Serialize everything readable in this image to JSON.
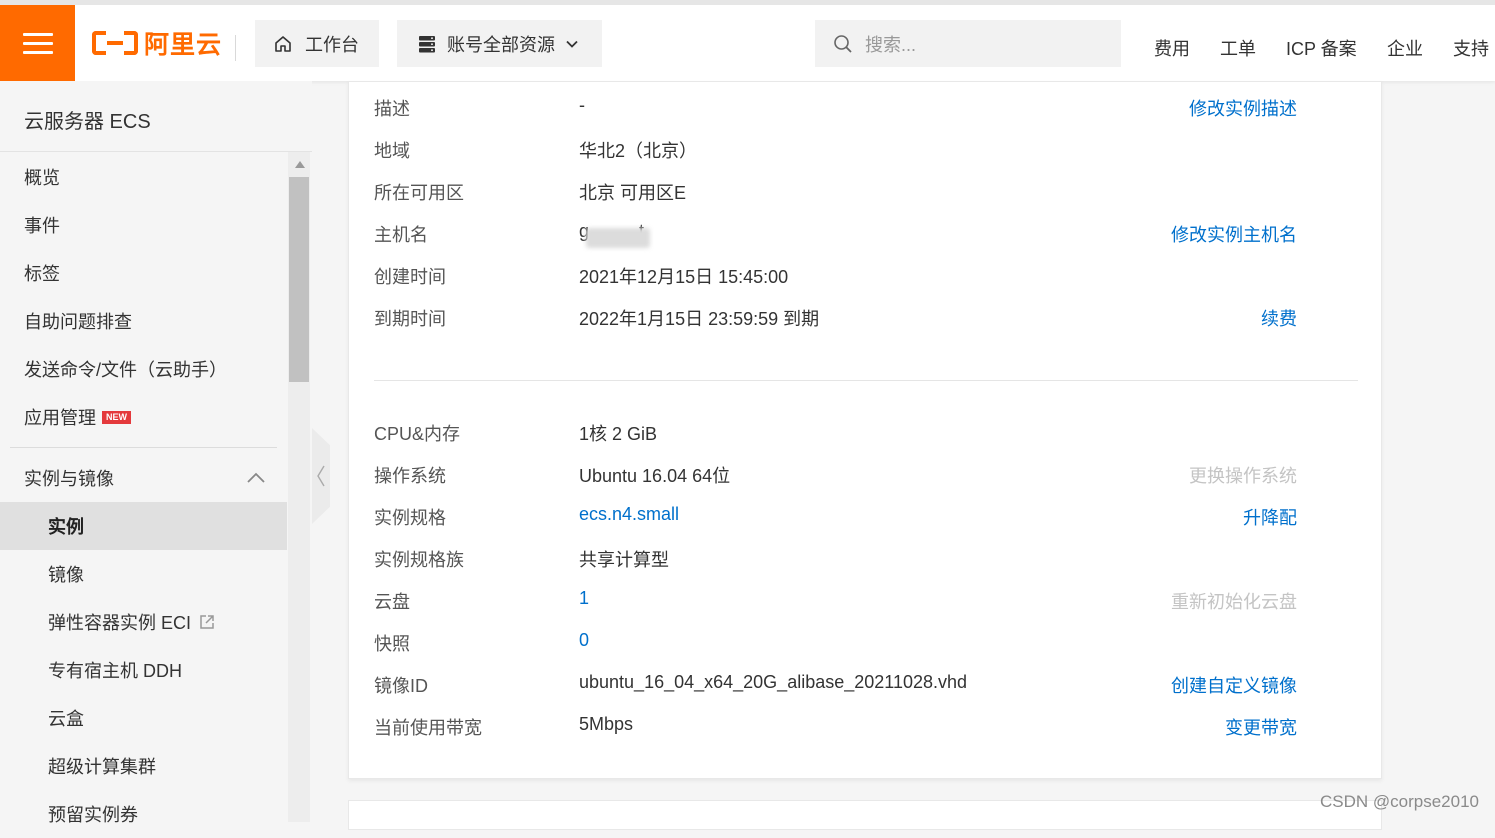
{
  "header": {
    "logo_text": "阿里云",
    "workbench_label": "工作台",
    "resources_label": "账号全部资源",
    "search_placeholder": "搜索...",
    "nav": [
      "费用",
      "工单",
      "ICP 备案",
      "企业",
      "支持"
    ]
  },
  "sidebar": {
    "title": "云服务器 ECS",
    "top_items": [
      "概览",
      "事件",
      "标签",
      "自助问题排查",
      "发送命令/文件（云助手）",
      "应用管理"
    ],
    "new_badge": "NEW",
    "group_label": "实例与镜像",
    "sub_items": [
      "实例",
      "镜像",
      "弹性容器实例 ECI",
      "专有宿主机 DDH",
      "云盒",
      "超级计算集群",
      "预留实例券"
    ],
    "active_item": "实例"
  },
  "basic_info": [
    {
      "label": "描述",
      "value": "-",
      "action": "修改实例描述"
    },
    {
      "label": "地域",
      "value": "华北2（北京）",
      "action": ""
    },
    {
      "label": "所在可用区",
      "value": "北京 可用区E",
      "action": ""
    },
    {
      "label": "主机名",
      "value": "g          t",
      "action": "修改实例主机名"
    },
    {
      "label": "创建时间",
      "value": "2021年12月15日 15:45:00",
      "action": ""
    },
    {
      "label": "到期时间",
      "value": "2022年1月15日 23:59:59 到期",
      "action": "续费"
    }
  ],
  "config_info": [
    {
      "label": "CPU&内存",
      "value": "1核 2 GiB",
      "action": ""
    },
    {
      "label": "操作系统",
      "value": "Ubuntu 16.04 64位",
      "action": "更换操作系统"
    },
    {
      "label": "实例规格",
      "value": "ecs.n4.small",
      "action": "升降配"
    },
    {
      "label": "实例规格族",
      "value": "共享计算型",
      "action": ""
    },
    {
      "label": "云盘",
      "value": "1",
      "action": "重新初始化云盘"
    },
    {
      "label": "快照",
      "value": "0",
      "action": ""
    },
    {
      "label": "镜像ID",
      "value": "ubuntu_16_04_x64_20G_alibase_20211028.vhd",
      "action": "创建自定义镜像"
    },
    {
      "label": "当前使用带宽",
      "value": "5Mbps",
      "action": "变更带宽"
    }
  ],
  "watermark": "CSDN @corpse2010",
  "colors": {
    "brand": "#ff6a00",
    "link": "#0070cc",
    "disabled": "#c4c4c4"
  }
}
